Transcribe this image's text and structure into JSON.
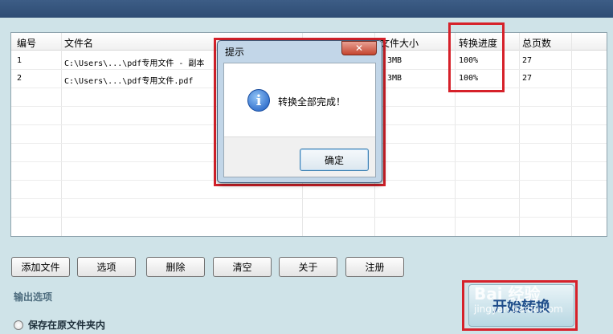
{
  "table": {
    "headers": {
      "id": "编号",
      "filename": "文件名",
      "size": "文件大小",
      "progress": "转换进度",
      "pages": "总页数"
    },
    "rows": [
      {
        "id": "1",
        "filename": "C:\\Users\\...\\pdf专用文件 - 副本",
        "size": "3MB",
        "progress": "100%",
        "pages": "27"
      },
      {
        "id": "2",
        "filename": "C:\\Users\\...\\pdf专用文件.pdf",
        "size": "3MB",
        "progress": "100%",
        "pages": "27"
      }
    ]
  },
  "toolbar": {
    "add_file": "添加文件",
    "options": "选项",
    "delete": "删除",
    "clear": "清空",
    "about": "关于",
    "register": "注册"
  },
  "output": {
    "section_label": "输出选项",
    "save_original_label": "保存在原文件夹内"
  },
  "start_button": {
    "label": "开始转换"
  },
  "watermark": {
    "text": "Bai 经验",
    "sub": "jingyan.baidu.com"
  },
  "dialog": {
    "title": "提示",
    "close_label": "✕",
    "message": "转换全部完成！",
    "ok_label": "确定",
    "icon": "info-icon"
  },
  "colors": {
    "highlight": "#d6212a",
    "window_bg": "#cfe3e8",
    "title_strip": "#2e4c74"
  }
}
